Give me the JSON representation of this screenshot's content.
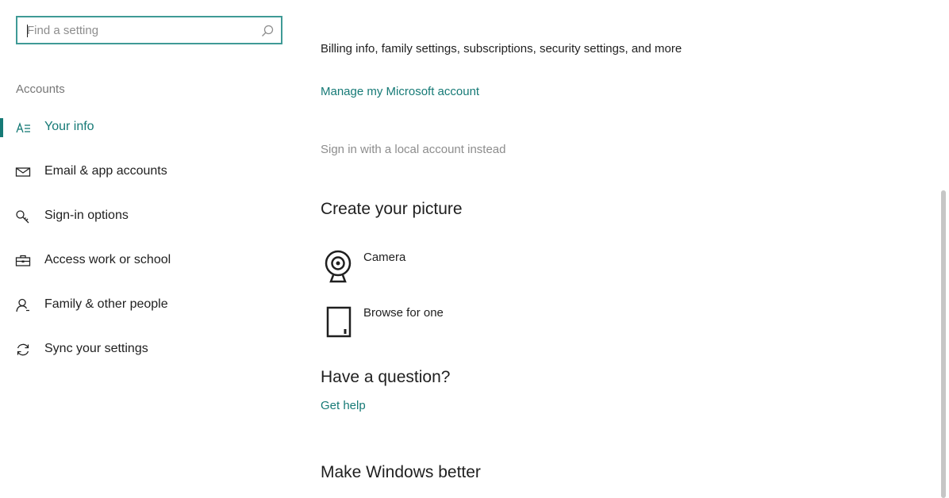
{
  "search": {
    "placeholder": "Find a setting"
  },
  "sidebar": {
    "section_title": "Accounts",
    "items": [
      {
        "label": "Your info",
        "icon": "person-card-icon",
        "selected": true
      },
      {
        "label": "Email & app accounts",
        "icon": "mail-icon",
        "selected": false
      },
      {
        "label": "Sign-in options",
        "icon": "key-icon",
        "selected": false
      },
      {
        "label": "Access work or school",
        "icon": "briefcase-icon",
        "selected": false
      },
      {
        "label": "Family & other people",
        "icon": "person-icon",
        "selected": false
      },
      {
        "label": "Sync your settings",
        "icon": "sync-icon",
        "selected": false
      }
    ]
  },
  "main": {
    "account_description": "Billing info, family settings, subscriptions, security settings, and more",
    "manage_account_link": "Manage my Microsoft account",
    "local_account_link": "Sign in with a local account instead",
    "create_picture": {
      "title": "Create your picture",
      "options": [
        {
          "label": "Camera",
          "icon": "camera-icon"
        },
        {
          "label": "Browse for one",
          "icon": "browse-file-icon"
        }
      ]
    },
    "question": {
      "title": "Have a question?",
      "link": "Get help"
    },
    "better": {
      "title": "Make Windows better"
    }
  },
  "colors": {
    "accent": "#167a76",
    "search_border": "#3f9a96",
    "muted_text": "#8d8d8d"
  }
}
